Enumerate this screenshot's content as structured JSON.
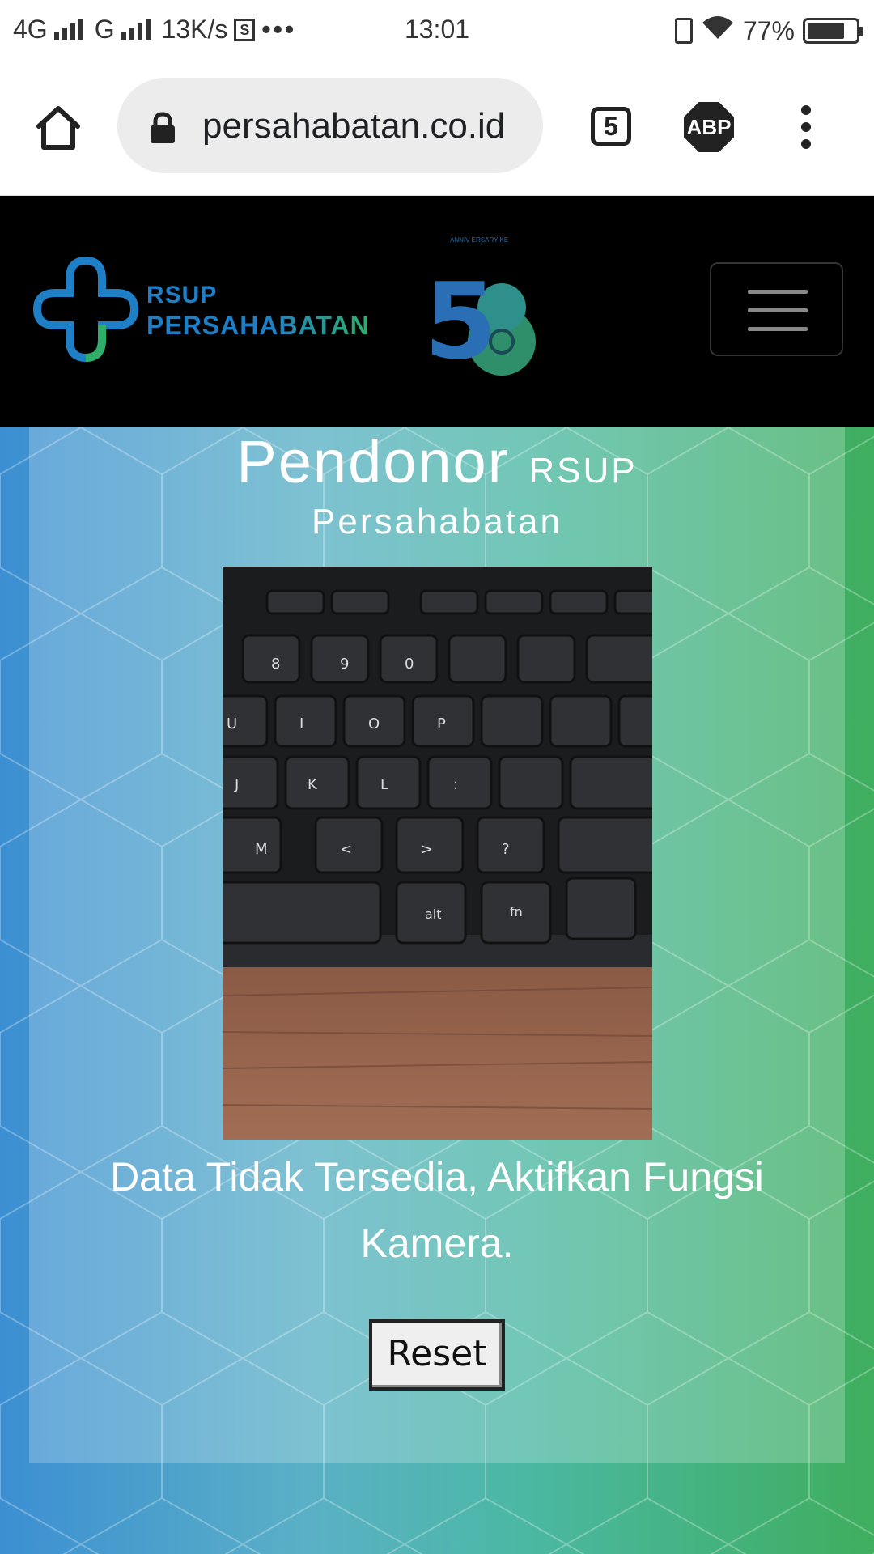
{
  "status_bar": {
    "network1": "4G",
    "network2": "G",
    "speed": "13K/s",
    "sim_icon_label": "S",
    "more": "•••",
    "time": "13:01",
    "battery": "77%",
    "battery_level": 0.77
  },
  "browser": {
    "url": "persahabatan.co.id",
    "tab_count": "5",
    "adblock_label": "ABP",
    "icons": [
      "home-icon",
      "lock-icon",
      "tabs-icon",
      "adblock-icon",
      "menu-icon"
    ]
  },
  "site_header": {
    "logo_line1": "RSUP",
    "logo_line2": "PERSAHABATAN",
    "anniversary_number": "58",
    "anniversary_caption": "ANNIV ERSARY KE"
  },
  "page": {
    "title_main": "Pendonor",
    "title_sub1": "RSUP",
    "title_sub2": "Persahabatan",
    "message": "Data Tidak Tersedia, Aktifkan Fungsi Kamera.",
    "reset_label": "Reset"
  },
  "colors": {
    "header_bg": "#000000",
    "gradient_left": "#3c8fd2",
    "gradient_right": "#3fae5e",
    "logo_blue": "#1e7fc6",
    "logo_green": "#2fae6a"
  }
}
